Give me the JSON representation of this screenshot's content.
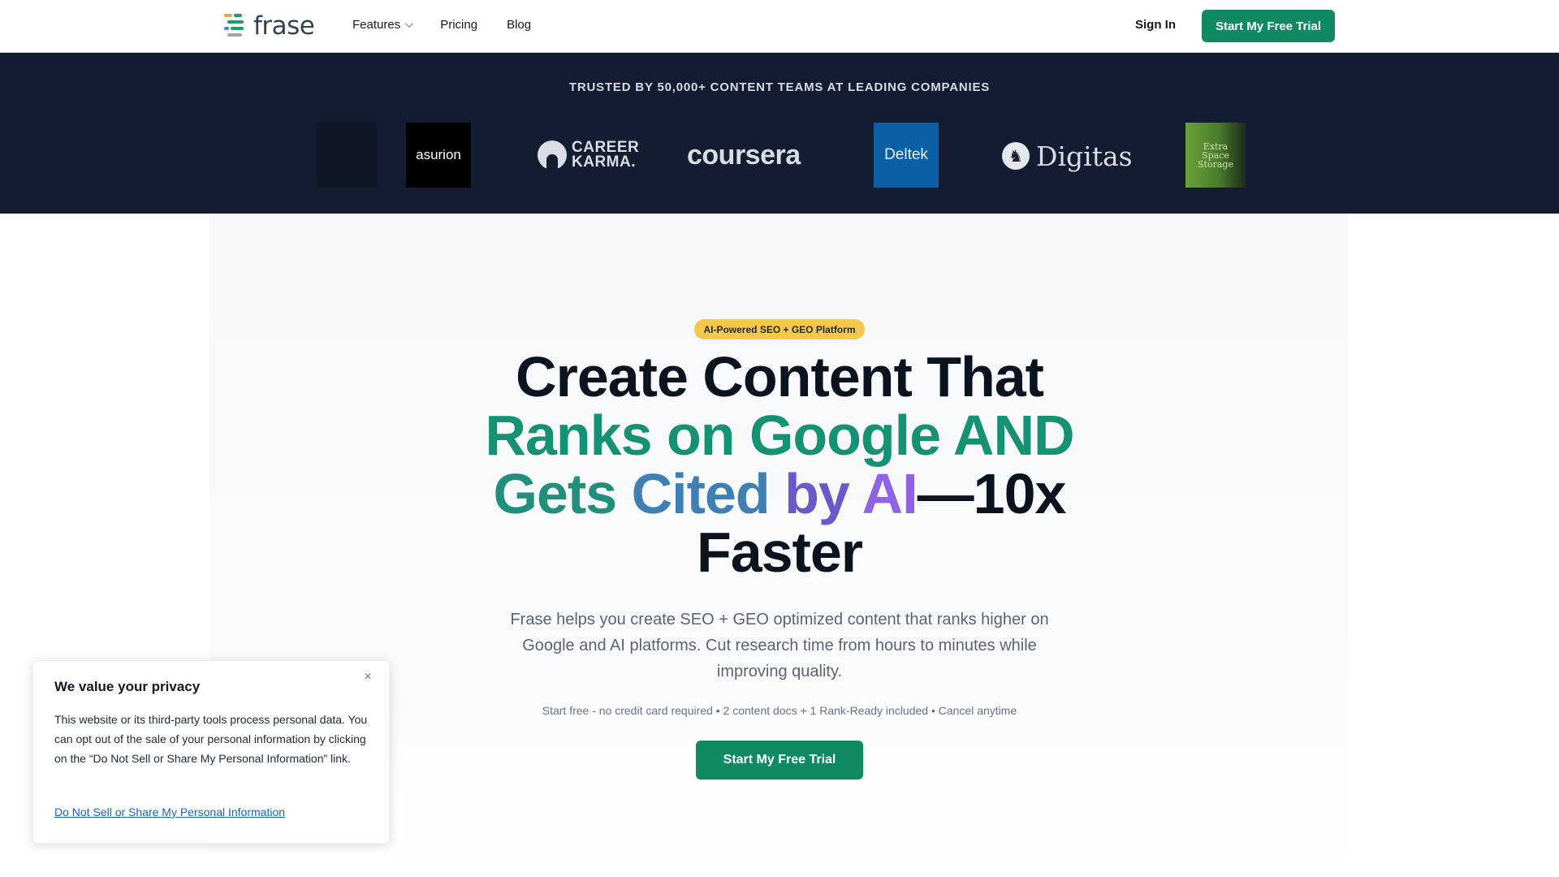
{
  "header": {
    "logo_text": "frase",
    "nav": [
      {
        "label": "Features",
        "has_dropdown": true
      },
      {
        "label": "Pricing"
      },
      {
        "label": "Blog"
      }
    ],
    "sign_in": "Sign In",
    "cta": "Start My Free Trial"
  },
  "trusted": {
    "title": "TRUSTED BY 50,000+ CONTENT TEAMS AT LEADING COMPANIES",
    "logos": {
      "asurion": "asurion",
      "career_line1": "CAREER",
      "career_line2": "KARMA.",
      "coursera": "coursera",
      "deltek": "Deltek",
      "digitas": "Digitas",
      "extra_line1": "Extra",
      "extra_line2": "Space",
      "extra_line3": "Storage"
    }
  },
  "hero": {
    "badge": "AI-Powered SEO + GEO Platform",
    "headline": {
      "line1": "Create Content That",
      "line2": "Ranks on Google AND",
      "line3_a": "Gets",
      "line3_b": "Cited",
      "line3_c": "by",
      "line3_d": "AI",
      "line3_e": "—10x",
      "line4": "Faster"
    },
    "subtitle": "Frase helps you create SEO + GEO optimized content that ranks higher on Google and AI platforms. Cut research time from hours to minutes while improving quality.",
    "fine_print": "Start free - no credit card required • 2 content docs + 1 Rank-Ready included • Cancel anytime",
    "cta": "Start My Free Trial"
  },
  "privacy": {
    "title": "We value your privacy",
    "text": "This website or its third-party tools process personal data. You can opt out of the sale of your personal information by clicking on the “Do Not Sell or Share My Personal Information” link.",
    "link": "Do Not Sell or Share My Personal Information",
    "close_icon": "×"
  },
  "colors": {
    "brand_green": "#0f8a63",
    "band_bg": "#131c30",
    "badge_yellow": "#f5c84c"
  }
}
